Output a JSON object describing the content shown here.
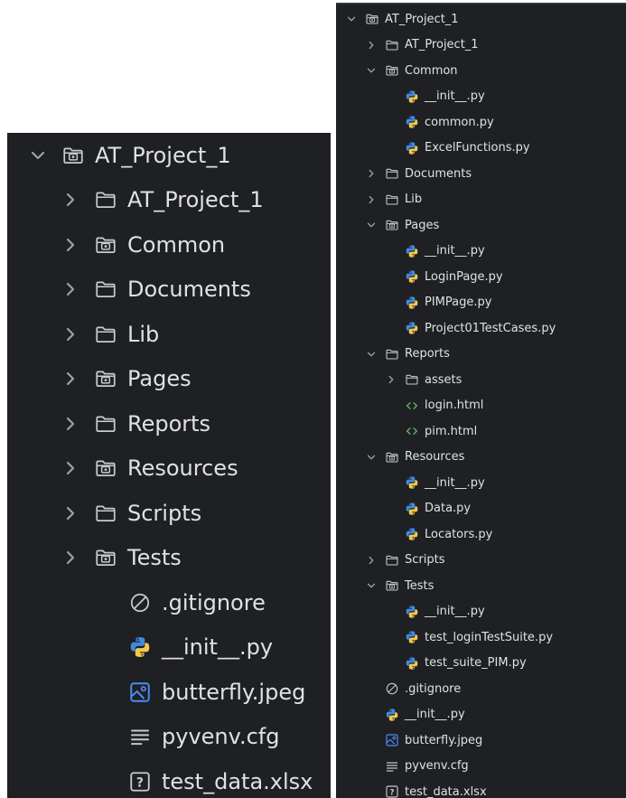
{
  "left_tree": {
    "root": {
      "label": "AT_Project_1",
      "icon": "module-folder-icon",
      "state": "expanded"
    },
    "items": [
      {
        "label": "AT_Project_1",
        "icon": "folder-icon",
        "state": "collapsed"
      },
      {
        "label": "Common",
        "icon": "module-folder-icon",
        "state": "collapsed"
      },
      {
        "label": "Documents",
        "icon": "folder-icon",
        "state": "collapsed"
      },
      {
        "label": "Lib",
        "icon": "folder-icon",
        "state": "collapsed"
      },
      {
        "label": "Pages",
        "icon": "module-folder-icon",
        "state": "collapsed"
      },
      {
        "label": "Reports",
        "icon": "folder-icon",
        "state": "collapsed"
      },
      {
        "label": "Resources",
        "icon": "module-folder-icon",
        "state": "collapsed"
      },
      {
        "label": "Scripts",
        "icon": "folder-icon",
        "state": "collapsed"
      },
      {
        "label": "Tests",
        "icon": "module-folder-icon",
        "state": "collapsed"
      },
      {
        "label": ".gitignore",
        "icon": "ignored-file-icon"
      },
      {
        "label": "__init__.py",
        "icon": "python-file-icon"
      },
      {
        "label": "butterfly.jpeg",
        "icon": "image-file-icon"
      },
      {
        "label": "pyvenv.cfg",
        "icon": "text-file-icon"
      },
      {
        "label": "test_data.xlsx",
        "icon": "unknown-file-icon"
      }
    ]
  },
  "right_tree": {
    "items": [
      {
        "label": "AT_Project_1",
        "icon": "module-folder-icon",
        "state": "expanded",
        "depth": 0
      },
      {
        "label": "AT_Project_1",
        "icon": "folder-icon",
        "state": "collapsed",
        "depth": 1
      },
      {
        "label": "Common",
        "icon": "module-folder-icon",
        "state": "expanded",
        "depth": 1
      },
      {
        "label": "__init__.py",
        "icon": "python-file-icon",
        "depth": 2
      },
      {
        "label": "common.py",
        "icon": "python-file-icon",
        "depth": 2
      },
      {
        "label": "ExcelFunctions.py",
        "icon": "python-file-icon",
        "depth": 2
      },
      {
        "label": "Documents",
        "icon": "folder-icon",
        "state": "collapsed",
        "depth": 1
      },
      {
        "label": "Lib",
        "icon": "folder-icon",
        "state": "collapsed",
        "depth": 1
      },
      {
        "label": "Pages",
        "icon": "module-folder-icon",
        "state": "expanded",
        "depth": 1
      },
      {
        "label": "__init__.py",
        "icon": "python-file-icon",
        "depth": 2
      },
      {
        "label": "LoginPage.py",
        "icon": "python-file-icon",
        "depth": 2
      },
      {
        "label": "PIMPage.py",
        "icon": "python-file-icon",
        "depth": 2
      },
      {
        "label": "Project01TestCases.py",
        "icon": "python-file-icon",
        "depth": 2
      },
      {
        "label": "Reports",
        "icon": "folder-icon",
        "state": "expanded",
        "depth": 1
      },
      {
        "label": "assets",
        "icon": "folder-icon",
        "state": "collapsed",
        "depth": 2
      },
      {
        "label": "login.html",
        "icon": "html-file-icon",
        "depth": 2
      },
      {
        "label": "pim.html",
        "icon": "html-file-icon",
        "depth": 2
      },
      {
        "label": "Resources",
        "icon": "module-folder-icon",
        "state": "expanded",
        "depth": 1
      },
      {
        "label": "__init__.py",
        "icon": "python-file-icon",
        "depth": 2
      },
      {
        "label": "Data.py",
        "icon": "python-file-icon",
        "depth": 2
      },
      {
        "label": "Locators.py",
        "icon": "python-file-icon",
        "depth": 2
      },
      {
        "label": "Scripts",
        "icon": "folder-icon",
        "state": "collapsed",
        "depth": 1
      },
      {
        "label": "Tests",
        "icon": "module-folder-icon",
        "state": "expanded",
        "depth": 1
      },
      {
        "label": "__init__.py",
        "icon": "python-file-icon",
        "depth": 2
      },
      {
        "label": "test_loginTestSuite.py",
        "icon": "python-file-icon",
        "depth": 2
      },
      {
        "label": "test_suite_PIM.py",
        "icon": "python-file-icon",
        "depth": 2
      },
      {
        "label": ".gitignore",
        "icon": "ignored-file-icon",
        "depth": 1
      },
      {
        "label": "__init__.py",
        "icon": "python-file-icon",
        "depth": 1
      },
      {
        "label": "butterfly.jpeg",
        "icon": "image-file-icon",
        "depth": 1
      },
      {
        "label": "pyvenv.cfg",
        "icon": "text-file-icon",
        "depth": 1
      },
      {
        "label": "test_data.xlsx",
        "icon": "unknown-file-icon",
        "depth": 1
      }
    ]
  },
  "colors": {
    "panel_bg": "#1f2024",
    "text": "#dfe1e5",
    "chevron": "#9da0a8",
    "folder_stroke": "#c8cacf",
    "python_blue": "#3f8ae0",
    "python_yellow": "#f2c94c",
    "html_green": "#5fb865",
    "image_blue": "#4b8df7"
  }
}
